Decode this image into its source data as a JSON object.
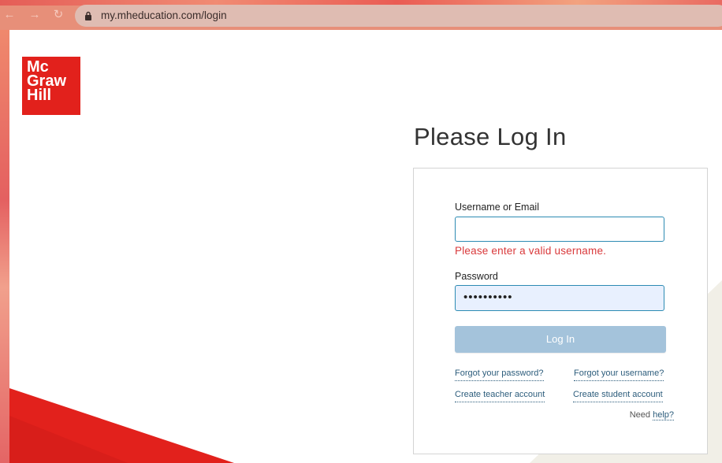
{
  "browser": {
    "url": "my.mheducation.com/login"
  },
  "logo": {
    "line1": "Mc",
    "line2": "Graw",
    "line3": "Hill"
  },
  "login": {
    "title": "Please Log In",
    "username_label": "Username or Email",
    "username_value": "",
    "username_error": "Please enter a valid username.",
    "password_label": "Password",
    "password_mask": "••••••••••",
    "login_button": "Log In",
    "forgot_password": "Forgot your password?",
    "forgot_username": "Forgot your username?",
    "create_teacher": "Create teacher account",
    "create_student": "Create student account",
    "need_text": "Need",
    "help_link": "help?"
  },
  "colors": {
    "brand_red": "#e2211c",
    "error_red": "#d9393b",
    "input_border": "#2d8bb3",
    "button_disabled": "#a4c3db",
    "link": "#2d5d7c"
  }
}
